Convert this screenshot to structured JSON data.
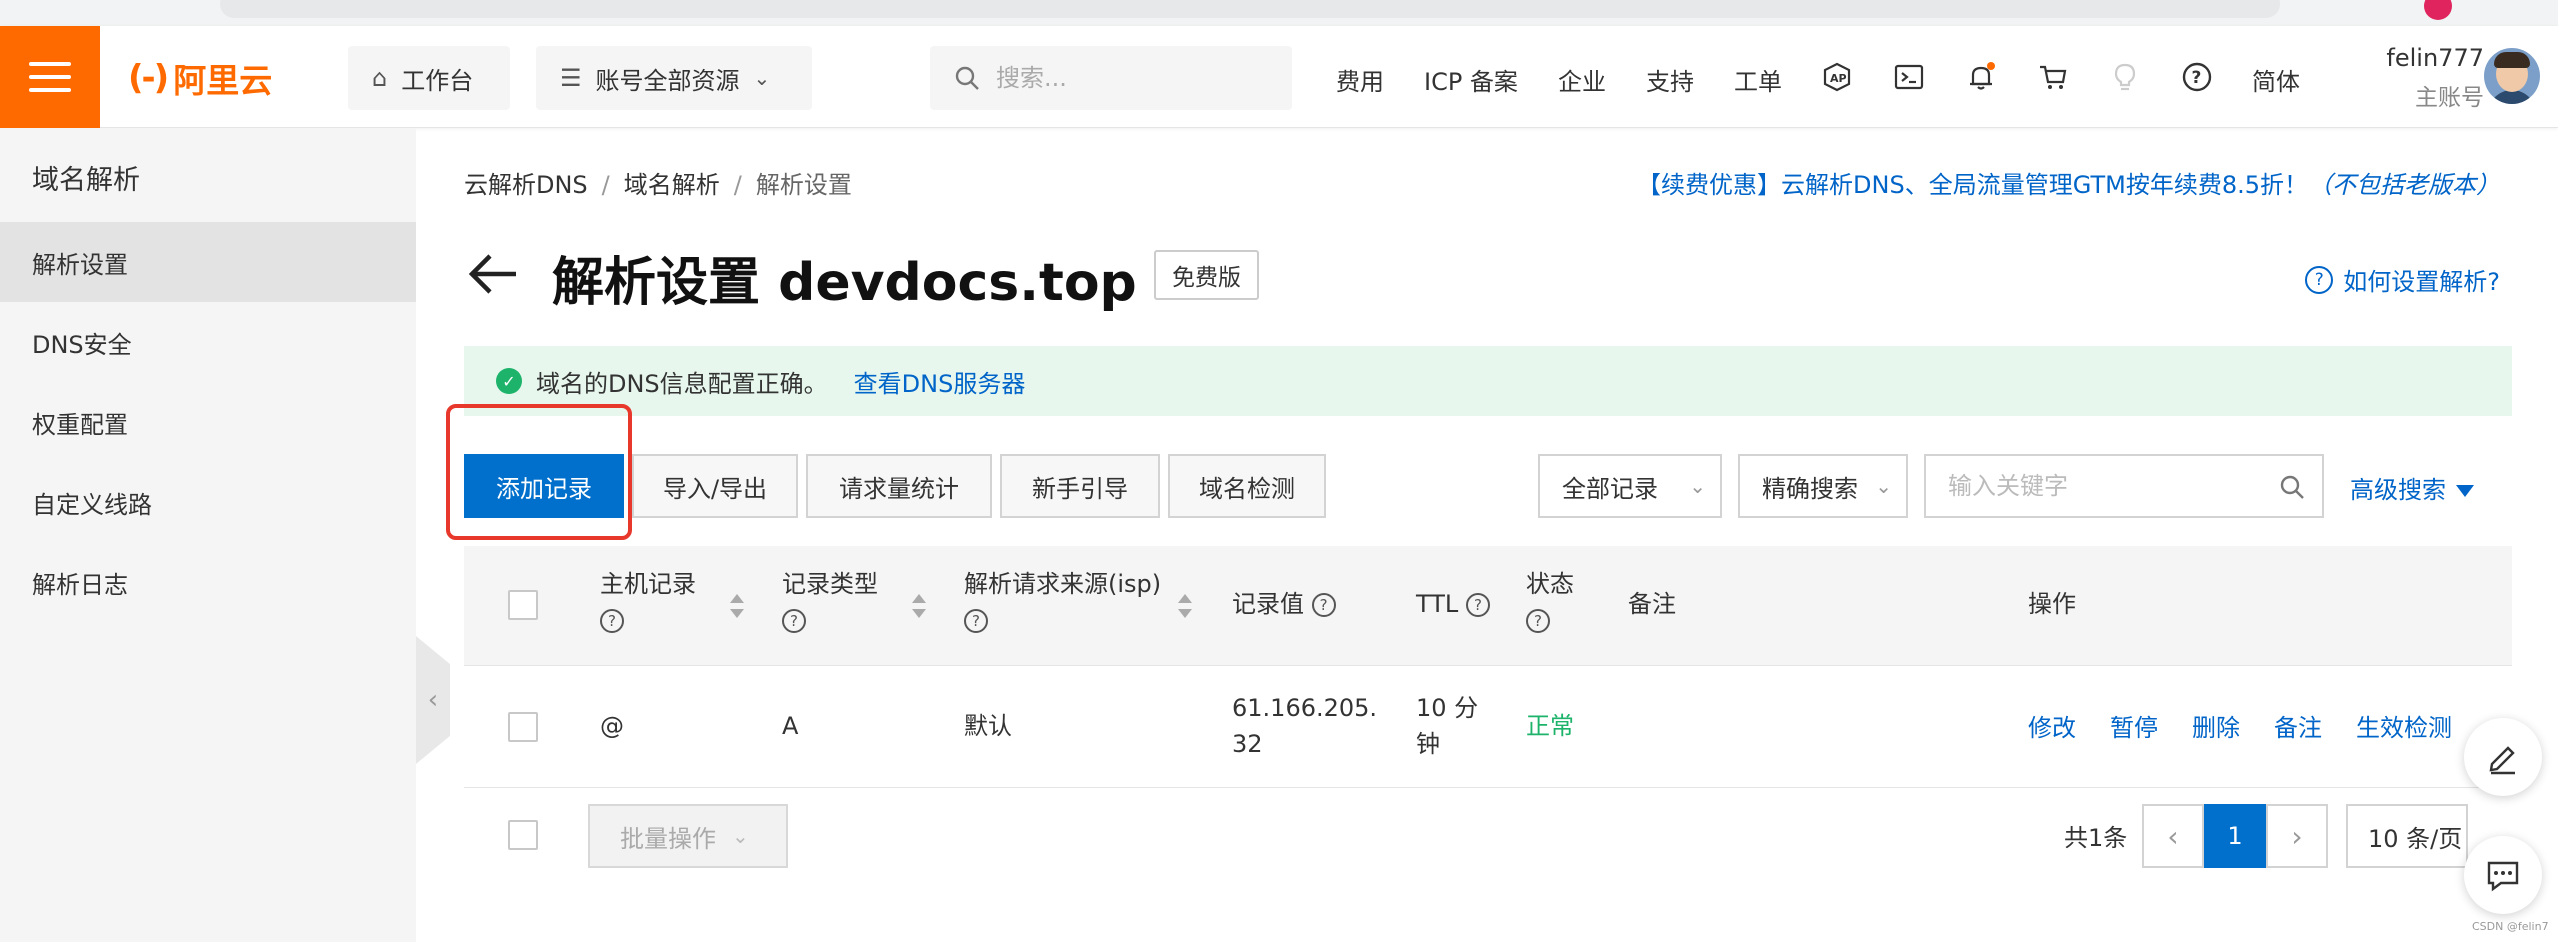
{
  "topnav": {
    "logo_text": "阿里云",
    "workbench": "工作台",
    "resources": "账号全部资源",
    "search_placeholder": "搜索...",
    "links": [
      "费用",
      "ICP 备案",
      "企业",
      "支持",
      "工单"
    ],
    "lang": "简体",
    "user_name": "felin777",
    "user_role": "主账号",
    "accent": "#ff6a00"
  },
  "sidebar": {
    "title": "域名解析",
    "items": [
      {
        "label": "解析设置",
        "active": true
      },
      {
        "label": "DNS安全",
        "active": false
      },
      {
        "label": "权重配置",
        "active": false
      },
      {
        "label": "自定义线路",
        "active": false
      },
      {
        "label": "解析日志",
        "active": false
      }
    ]
  },
  "breadcrumb": [
    "云解析DNS",
    "域名解析",
    "解析设置"
  ],
  "promo": {
    "main": "【续费优惠】云解析DNS、全局流量管理GTM按年续费8.5折！",
    "note": "（不包括老版本）"
  },
  "page": {
    "title": "解析设置 devdocs.top",
    "edition_badge": "免费版",
    "help_link": "如何设置解析?"
  },
  "alert": {
    "text": "域名的DNS信息配置正确。",
    "link": "查看DNS服务器",
    "color": "#1eb36b"
  },
  "toolbar": {
    "add_record": "添加记录",
    "import_export": "导入/导出",
    "request_stats": "请求量统计",
    "guide": "新手引导",
    "domain_check": "域名检测",
    "all_records": "全部记录",
    "exact_search": "精确搜索",
    "keyword_placeholder": "输入关键字",
    "advanced_search": "高级搜索",
    "primary_color": "#0070cc"
  },
  "table": {
    "headers": {
      "host": "主机记录",
      "type": "记录类型",
      "isp": "解析请求来源(isp)",
      "value": "记录值",
      "ttl": "TTL",
      "status": "状态",
      "remark": "备注",
      "actions": "操作"
    },
    "rows": [
      {
        "host": "@",
        "type": "A",
        "isp": "默认",
        "value_line1": "61.166.205.",
        "value_line2": "32",
        "ttl_line1": "10 分",
        "ttl_line2": "钟",
        "status": "正常",
        "remark": ""
      }
    ],
    "row_actions": [
      "修改",
      "暂停",
      "删除",
      "备注",
      "生效检测"
    ]
  },
  "footer": {
    "batch": "批量操作",
    "total": "共1条",
    "current_page": "1",
    "per_page": "10 条/页"
  },
  "watermark": "CSDN @felin7"
}
